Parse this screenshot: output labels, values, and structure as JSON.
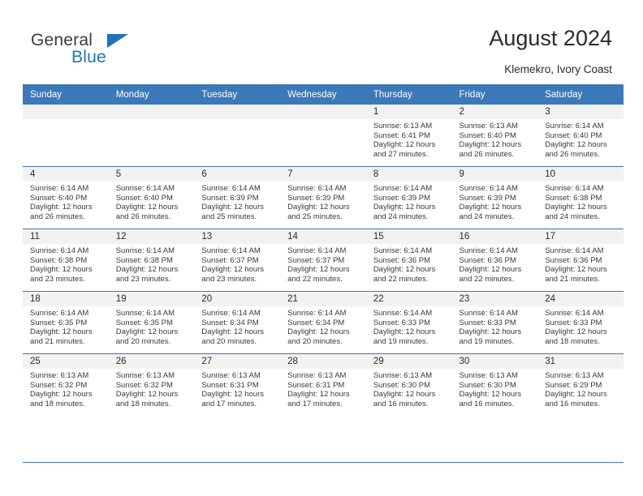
{
  "brand": {
    "name_top": "General",
    "name_bottom": "Blue",
    "accent_color": "#1d73bd"
  },
  "header": {
    "title": "August 2024",
    "subtitle": "Klemekro, Ivory Coast"
  },
  "theme": {
    "header_bg": "#3b79b9",
    "daynum_bg": "#f2f2f2",
    "grid_line": "#3b79b9",
    "text": "#2b2b2b"
  },
  "weekday_headers": [
    "Sunday",
    "Monday",
    "Tuesday",
    "Wednesday",
    "Thursday",
    "Friday",
    "Saturday"
  ],
  "labels": {
    "sunrise_prefix": "Sunrise:",
    "sunset_prefix": "Sunset:",
    "daylight_prefix": "Daylight:"
  },
  "weeks": [
    [
      {
        "day": "",
        "line1": "",
        "line2": "",
        "line3": "",
        "line4": ""
      },
      {
        "day": "",
        "line1": "",
        "line2": "",
        "line3": "",
        "line4": ""
      },
      {
        "day": "",
        "line1": "",
        "line2": "",
        "line3": "",
        "line4": ""
      },
      {
        "day": "",
        "line1": "",
        "line2": "",
        "line3": "",
        "line4": ""
      },
      {
        "day": "1",
        "line1": "Sunrise: 6:13 AM",
        "line2": "Sunset: 6:41 PM",
        "line3": "Daylight: 12 hours",
        "line4": "and 27 minutes."
      },
      {
        "day": "2",
        "line1": "Sunrise: 6:13 AM",
        "line2": "Sunset: 6:40 PM",
        "line3": "Daylight: 12 hours",
        "line4": "and 26 minutes."
      },
      {
        "day": "3",
        "line1": "Sunrise: 6:14 AM",
        "line2": "Sunset: 6:40 PM",
        "line3": "Daylight: 12 hours",
        "line4": "and 26 minutes."
      }
    ],
    [
      {
        "day": "4",
        "line1": "Sunrise: 6:14 AM",
        "line2": "Sunset: 6:40 PM",
        "line3": "Daylight: 12 hours",
        "line4": "and 26 minutes."
      },
      {
        "day": "5",
        "line1": "Sunrise: 6:14 AM",
        "line2": "Sunset: 6:40 PM",
        "line3": "Daylight: 12 hours",
        "line4": "and 26 minutes."
      },
      {
        "day": "6",
        "line1": "Sunrise: 6:14 AM",
        "line2": "Sunset: 6:39 PM",
        "line3": "Daylight: 12 hours",
        "line4": "and 25 minutes."
      },
      {
        "day": "7",
        "line1": "Sunrise: 6:14 AM",
        "line2": "Sunset: 6:39 PM",
        "line3": "Daylight: 12 hours",
        "line4": "and 25 minutes."
      },
      {
        "day": "8",
        "line1": "Sunrise: 6:14 AM",
        "line2": "Sunset: 6:39 PM",
        "line3": "Daylight: 12 hours",
        "line4": "and 24 minutes."
      },
      {
        "day": "9",
        "line1": "Sunrise: 6:14 AM",
        "line2": "Sunset: 6:39 PM",
        "line3": "Daylight: 12 hours",
        "line4": "and 24 minutes."
      },
      {
        "day": "10",
        "line1": "Sunrise: 6:14 AM",
        "line2": "Sunset: 6:38 PM",
        "line3": "Daylight: 12 hours",
        "line4": "and 24 minutes."
      }
    ],
    [
      {
        "day": "11",
        "line1": "Sunrise: 6:14 AM",
        "line2": "Sunset: 6:38 PM",
        "line3": "Daylight: 12 hours",
        "line4": "and 23 minutes."
      },
      {
        "day": "12",
        "line1": "Sunrise: 6:14 AM",
        "line2": "Sunset: 6:38 PM",
        "line3": "Daylight: 12 hours",
        "line4": "and 23 minutes."
      },
      {
        "day": "13",
        "line1": "Sunrise: 6:14 AM",
        "line2": "Sunset: 6:37 PM",
        "line3": "Daylight: 12 hours",
        "line4": "and 23 minutes."
      },
      {
        "day": "14",
        "line1": "Sunrise: 6:14 AM",
        "line2": "Sunset: 6:37 PM",
        "line3": "Daylight: 12 hours",
        "line4": "and 22 minutes."
      },
      {
        "day": "15",
        "line1": "Sunrise: 6:14 AM",
        "line2": "Sunset: 6:36 PM",
        "line3": "Daylight: 12 hours",
        "line4": "and 22 minutes."
      },
      {
        "day": "16",
        "line1": "Sunrise: 6:14 AM",
        "line2": "Sunset: 6:36 PM",
        "line3": "Daylight: 12 hours",
        "line4": "and 22 minutes."
      },
      {
        "day": "17",
        "line1": "Sunrise: 6:14 AM",
        "line2": "Sunset: 6:36 PM",
        "line3": "Daylight: 12 hours",
        "line4": "and 21 minutes."
      }
    ],
    [
      {
        "day": "18",
        "line1": "Sunrise: 6:14 AM",
        "line2": "Sunset: 6:35 PM",
        "line3": "Daylight: 12 hours",
        "line4": "and 21 minutes."
      },
      {
        "day": "19",
        "line1": "Sunrise: 6:14 AM",
        "line2": "Sunset: 6:35 PM",
        "line3": "Daylight: 12 hours",
        "line4": "and 20 minutes."
      },
      {
        "day": "20",
        "line1": "Sunrise: 6:14 AM",
        "line2": "Sunset: 6:34 PM",
        "line3": "Daylight: 12 hours",
        "line4": "and 20 minutes."
      },
      {
        "day": "21",
        "line1": "Sunrise: 6:14 AM",
        "line2": "Sunset: 6:34 PM",
        "line3": "Daylight: 12 hours",
        "line4": "and 20 minutes."
      },
      {
        "day": "22",
        "line1": "Sunrise: 6:14 AM",
        "line2": "Sunset: 6:33 PM",
        "line3": "Daylight: 12 hours",
        "line4": "and 19 minutes."
      },
      {
        "day": "23",
        "line1": "Sunrise: 6:14 AM",
        "line2": "Sunset: 6:33 PM",
        "line3": "Daylight: 12 hours",
        "line4": "and 19 minutes."
      },
      {
        "day": "24",
        "line1": "Sunrise: 6:14 AM",
        "line2": "Sunset: 6:33 PM",
        "line3": "Daylight: 12 hours",
        "line4": "and 18 minutes."
      }
    ],
    [
      {
        "day": "25",
        "line1": "Sunrise: 6:13 AM",
        "line2": "Sunset: 6:32 PM",
        "line3": "Daylight: 12 hours",
        "line4": "and 18 minutes."
      },
      {
        "day": "26",
        "line1": "Sunrise: 6:13 AM",
        "line2": "Sunset: 6:32 PM",
        "line3": "Daylight: 12 hours",
        "line4": "and 18 minutes."
      },
      {
        "day": "27",
        "line1": "Sunrise: 6:13 AM",
        "line2": "Sunset: 6:31 PM",
        "line3": "Daylight: 12 hours",
        "line4": "and 17 minutes."
      },
      {
        "day": "28",
        "line1": "Sunrise: 6:13 AM",
        "line2": "Sunset: 6:31 PM",
        "line3": "Daylight: 12 hours",
        "line4": "and 17 minutes."
      },
      {
        "day": "29",
        "line1": "Sunrise: 6:13 AM",
        "line2": "Sunset: 6:30 PM",
        "line3": "Daylight: 12 hours",
        "line4": "and 16 minutes."
      },
      {
        "day": "30",
        "line1": "Sunrise: 6:13 AM",
        "line2": "Sunset: 6:30 PM",
        "line3": "Daylight: 12 hours",
        "line4": "and 16 minutes."
      },
      {
        "day": "31",
        "line1": "Sunrise: 6:13 AM",
        "line2": "Sunset: 6:29 PM",
        "line3": "Daylight: 12 hours",
        "line4": "and 16 minutes."
      }
    ]
  ]
}
